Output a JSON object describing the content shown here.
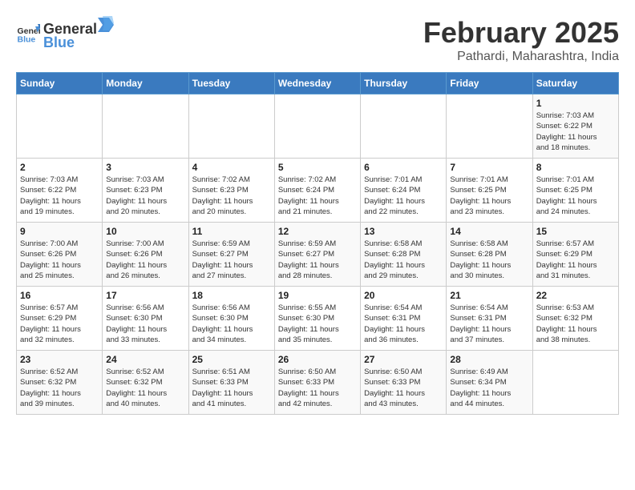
{
  "header": {
    "logo_general": "General",
    "logo_blue": "Blue",
    "month_title": "February 2025",
    "subtitle": "Pathardi, Maharashtra, India"
  },
  "weekdays": [
    "Sunday",
    "Monday",
    "Tuesday",
    "Wednesday",
    "Thursday",
    "Friday",
    "Saturday"
  ],
  "weeks": [
    [
      {
        "day": "",
        "info": ""
      },
      {
        "day": "",
        "info": ""
      },
      {
        "day": "",
        "info": ""
      },
      {
        "day": "",
        "info": ""
      },
      {
        "day": "",
        "info": ""
      },
      {
        "day": "",
        "info": ""
      },
      {
        "day": "1",
        "info": "Sunrise: 7:03 AM\nSunset: 6:22 PM\nDaylight: 11 hours\nand 18 minutes."
      }
    ],
    [
      {
        "day": "2",
        "info": "Sunrise: 7:03 AM\nSunset: 6:22 PM\nDaylight: 11 hours\nand 19 minutes."
      },
      {
        "day": "3",
        "info": "Sunrise: 7:03 AM\nSunset: 6:23 PM\nDaylight: 11 hours\nand 20 minutes."
      },
      {
        "day": "4",
        "info": "Sunrise: 7:02 AM\nSunset: 6:23 PM\nDaylight: 11 hours\nand 20 minutes."
      },
      {
        "day": "5",
        "info": "Sunrise: 7:02 AM\nSunset: 6:24 PM\nDaylight: 11 hours\nand 21 minutes."
      },
      {
        "day": "6",
        "info": "Sunrise: 7:01 AM\nSunset: 6:24 PM\nDaylight: 11 hours\nand 22 minutes."
      },
      {
        "day": "7",
        "info": "Sunrise: 7:01 AM\nSunset: 6:25 PM\nDaylight: 11 hours\nand 23 minutes."
      },
      {
        "day": "8",
        "info": "Sunrise: 7:01 AM\nSunset: 6:25 PM\nDaylight: 11 hours\nand 24 minutes."
      }
    ],
    [
      {
        "day": "9",
        "info": "Sunrise: 7:00 AM\nSunset: 6:26 PM\nDaylight: 11 hours\nand 25 minutes."
      },
      {
        "day": "10",
        "info": "Sunrise: 7:00 AM\nSunset: 6:26 PM\nDaylight: 11 hours\nand 26 minutes."
      },
      {
        "day": "11",
        "info": "Sunrise: 6:59 AM\nSunset: 6:27 PM\nDaylight: 11 hours\nand 27 minutes."
      },
      {
        "day": "12",
        "info": "Sunrise: 6:59 AM\nSunset: 6:27 PM\nDaylight: 11 hours\nand 28 minutes."
      },
      {
        "day": "13",
        "info": "Sunrise: 6:58 AM\nSunset: 6:28 PM\nDaylight: 11 hours\nand 29 minutes."
      },
      {
        "day": "14",
        "info": "Sunrise: 6:58 AM\nSunset: 6:28 PM\nDaylight: 11 hours\nand 30 minutes."
      },
      {
        "day": "15",
        "info": "Sunrise: 6:57 AM\nSunset: 6:29 PM\nDaylight: 11 hours\nand 31 minutes."
      }
    ],
    [
      {
        "day": "16",
        "info": "Sunrise: 6:57 AM\nSunset: 6:29 PM\nDaylight: 11 hours\nand 32 minutes."
      },
      {
        "day": "17",
        "info": "Sunrise: 6:56 AM\nSunset: 6:30 PM\nDaylight: 11 hours\nand 33 minutes."
      },
      {
        "day": "18",
        "info": "Sunrise: 6:56 AM\nSunset: 6:30 PM\nDaylight: 11 hours\nand 34 minutes."
      },
      {
        "day": "19",
        "info": "Sunrise: 6:55 AM\nSunset: 6:30 PM\nDaylight: 11 hours\nand 35 minutes."
      },
      {
        "day": "20",
        "info": "Sunrise: 6:54 AM\nSunset: 6:31 PM\nDaylight: 11 hours\nand 36 minutes."
      },
      {
        "day": "21",
        "info": "Sunrise: 6:54 AM\nSunset: 6:31 PM\nDaylight: 11 hours\nand 37 minutes."
      },
      {
        "day": "22",
        "info": "Sunrise: 6:53 AM\nSunset: 6:32 PM\nDaylight: 11 hours\nand 38 minutes."
      }
    ],
    [
      {
        "day": "23",
        "info": "Sunrise: 6:52 AM\nSunset: 6:32 PM\nDaylight: 11 hours\nand 39 minutes."
      },
      {
        "day": "24",
        "info": "Sunrise: 6:52 AM\nSunset: 6:32 PM\nDaylight: 11 hours\nand 40 minutes."
      },
      {
        "day": "25",
        "info": "Sunrise: 6:51 AM\nSunset: 6:33 PM\nDaylight: 11 hours\nand 41 minutes."
      },
      {
        "day": "26",
        "info": "Sunrise: 6:50 AM\nSunset: 6:33 PM\nDaylight: 11 hours\nand 42 minutes."
      },
      {
        "day": "27",
        "info": "Sunrise: 6:50 AM\nSunset: 6:33 PM\nDaylight: 11 hours\nand 43 minutes."
      },
      {
        "day": "28",
        "info": "Sunrise: 6:49 AM\nSunset: 6:34 PM\nDaylight: 11 hours\nand 44 minutes."
      },
      {
        "day": "",
        "info": ""
      }
    ]
  ]
}
